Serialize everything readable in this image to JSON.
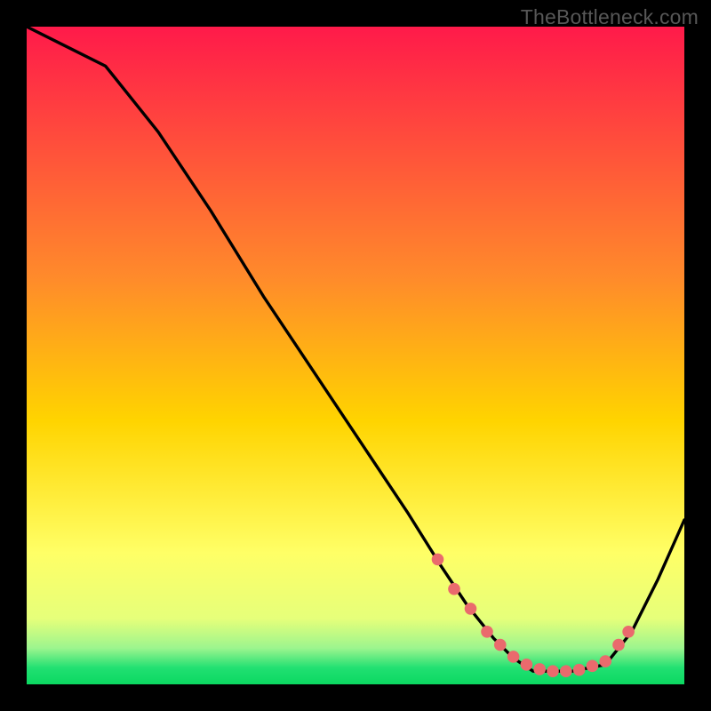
{
  "watermark": "TheBottleneck.com",
  "colors": {
    "panel_black": "#000000",
    "grad_top": "#ff1a4a",
    "grad_mid": "#ffd400",
    "grad_yellow_pale": "#ffff8a",
    "grad_green": "#17e06b",
    "curve_stroke": "#000000",
    "marker_fill": "#ea6a6d",
    "marker_stroke": "#d94f56"
  },
  "chart_data": {
    "type": "line",
    "title": "",
    "xlabel": "",
    "ylabel": "",
    "xlim": [
      0,
      100
    ],
    "ylim": [
      0,
      100
    ],
    "series": [
      {
        "name": "bottleneck-curve",
        "x": [
          0,
          6,
          12,
          20,
          28,
          36,
          44,
          52,
          58,
          63,
          67,
          71,
          74,
          77,
          80,
          83,
          88,
          92,
          96,
          100
        ],
        "y": [
          100,
          97,
          94,
          84,
          72,
          59,
          47,
          35,
          26,
          18,
          12,
          7,
          4,
          2,
          2,
          2,
          3,
          8,
          16,
          25
        ]
      }
    ],
    "markers": {
      "name": "highlighted-points",
      "x": [
        62.5,
        65,
        67.5,
        70,
        72,
        74,
        76,
        78,
        80,
        82,
        84,
        86,
        88,
        90,
        91.5
      ],
      "y": [
        19,
        14.5,
        11.5,
        8,
        6,
        4.2,
        3,
        2.3,
        2,
        2,
        2.2,
        2.8,
        3.5,
        6,
        8
      ]
    },
    "background_gradient": {
      "stops": [
        {
          "offset": 0.0,
          "color": "#ff1a4a"
        },
        {
          "offset": 0.38,
          "color": "#ff8a2b"
        },
        {
          "offset": 0.6,
          "color": "#ffd400"
        },
        {
          "offset": 0.8,
          "color": "#ffff66"
        },
        {
          "offset": 0.9,
          "color": "#e6ff7a"
        },
        {
          "offset": 0.945,
          "color": "#9cf58e"
        },
        {
          "offset": 0.975,
          "color": "#21e072"
        },
        {
          "offset": 1.0,
          "color": "#0bd861"
        }
      ]
    }
  }
}
